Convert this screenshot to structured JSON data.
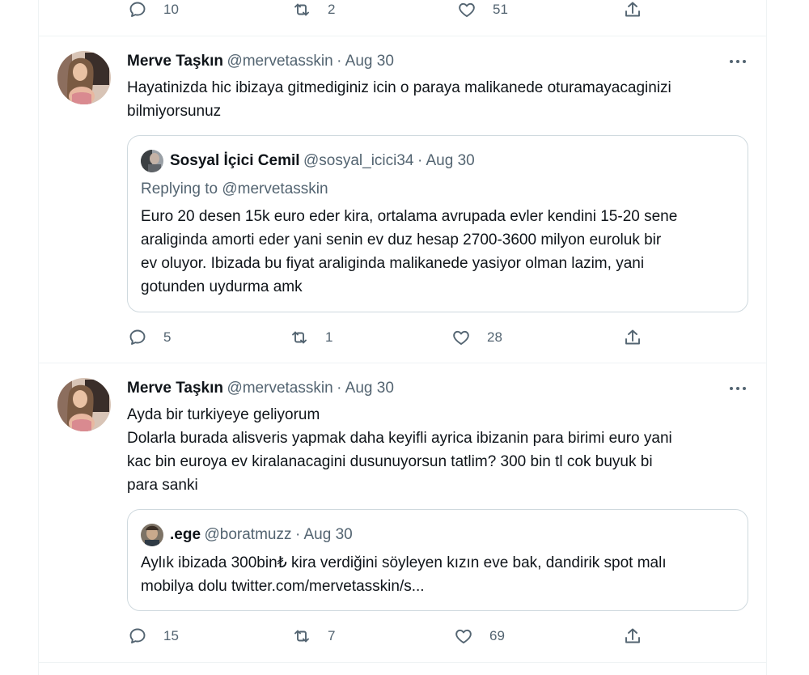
{
  "top_actions": {
    "replies": "10",
    "retweets": "2",
    "likes": "51"
  },
  "tweets": [
    {
      "author": "Merve Taşkın",
      "handle": "@mervetasskin",
      "date": "· Aug 30",
      "lines": [
        "Hayatinizda hic ibizaya gitmediginiz icin o paraya malikanede oturamayacaginizi",
        "bilmiyorsunuz"
      ],
      "quote": {
        "author": "Sosyal İçici Cemil",
        "handle": "@sosyal_icici34",
        "date": "· Aug 30",
        "replying_prefix": "Replying to ",
        "replying_to": "@mervetasskin",
        "lines": [
          "Euro 20 desen 15k euro eder kira, ortalama avrupada evler kendini 15-20 sene",
          "araliginda amorti eder yani senin ev duz hesap 2700-3600 milyon euroluk bir",
          "ev oluyor. Ibizada bu fiyat araliginda malikanede yasiyor olman lazim, yani",
          "gotunden uydurma amk"
        ]
      },
      "actions": {
        "replies": "5",
        "retweets": "1",
        "likes": "28"
      }
    },
    {
      "author": "Merve Taşkın",
      "handle": "@mervetasskin",
      "date": "· Aug 30",
      "lines": [
        "Ayda bir turkiyeye geliyorum",
        "Dolarla burada alisveris yapmak daha keyifli ayrica ibizanin para birimi euro yani",
        "kac bin euroya ev kiralanacagini dusunuyorsun tatlim? 300 bin tl cok buyuk bi",
        "para sanki"
      ],
      "quote": {
        "author": ".ege",
        "handle": "@boratmuzz",
        "date": "· Aug 30",
        "lines": [
          "Aylık ibizada 300bin₺ kira verdiğini söyleyen kızın eve bak, dandirik spot malı",
          "mobilya dolu twitter.com/mervetasskin/s..."
        ]
      },
      "actions": {
        "replies": "15",
        "retweets": "7",
        "likes": "69"
      }
    }
  ],
  "icons": [
    "reply-icon",
    "retweet-icon",
    "like-icon",
    "share-icon",
    "more-icon"
  ],
  "colors": {
    "text": "#0f1419",
    "secondary": "#536471",
    "border": "#cfd9de",
    "divider": "#eff3f4"
  }
}
